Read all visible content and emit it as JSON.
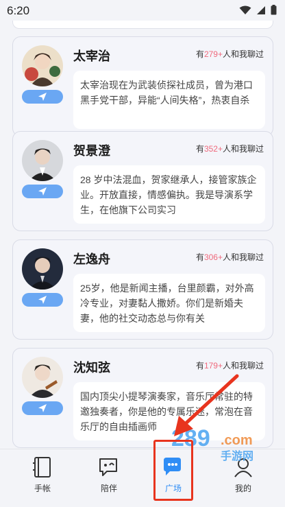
{
  "status": {
    "time": "6:20"
  },
  "characters": [
    {
      "name": "太宰治",
      "count_prefix": "有",
      "count": "279+",
      "count_suffix": "人和我聊过",
      "bio": "太宰治现在为武装侦探社成员，曾为港口黑手党干部，异能“人间失格”，热衷自杀"
    },
    {
      "name": "贺景澄",
      "count_prefix": "有",
      "count": "352+",
      "count_suffix": "人和我聊过",
      "bio": "28 岁中法混血，贺家继承人，接管家族企业。开放直接，情感偏执。我是导演系学生，在他旗下公司实习"
    },
    {
      "name": "左逸舟",
      "count_prefix": "有",
      "count": "306+",
      "count_suffix": "人和我聊过",
      "bio": "25岁，他是新闻主播，台里颜霸，对外高冷专业，对妻黏人撒娇。你们是新婚夫妻，他的社交动态总与你有关"
    },
    {
      "name": "沈知弦",
      "count_prefix": "有",
      "count": "179+",
      "count_suffix": "人和我聊过",
      "bio": "国内顶尖小提琴演奏家，音乐厅常驻的特邀独奏者，你是他的专属乐迷，常泡在音乐厅的自由插画师"
    }
  ],
  "nav": {
    "items": [
      {
        "label": "手帐",
        "icon": "notebook-icon"
      },
      {
        "label": "陪伴",
        "icon": "companion-icon"
      },
      {
        "label": "广场",
        "icon": "square-icon",
        "active": true
      },
      {
        "label": "我的",
        "icon": "profile-icon"
      }
    ]
  },
  "watermark": {
    "logo": "289",
    "domain": ".com",
    "tag": "手游网"
  },
  "colors": {
    "accent": "#6aa7f3",
    "count_highlight": "#ef6a7d",
    "annotation": "#e8341e",
    "active_nav": "#2f8df5"
  }
}
